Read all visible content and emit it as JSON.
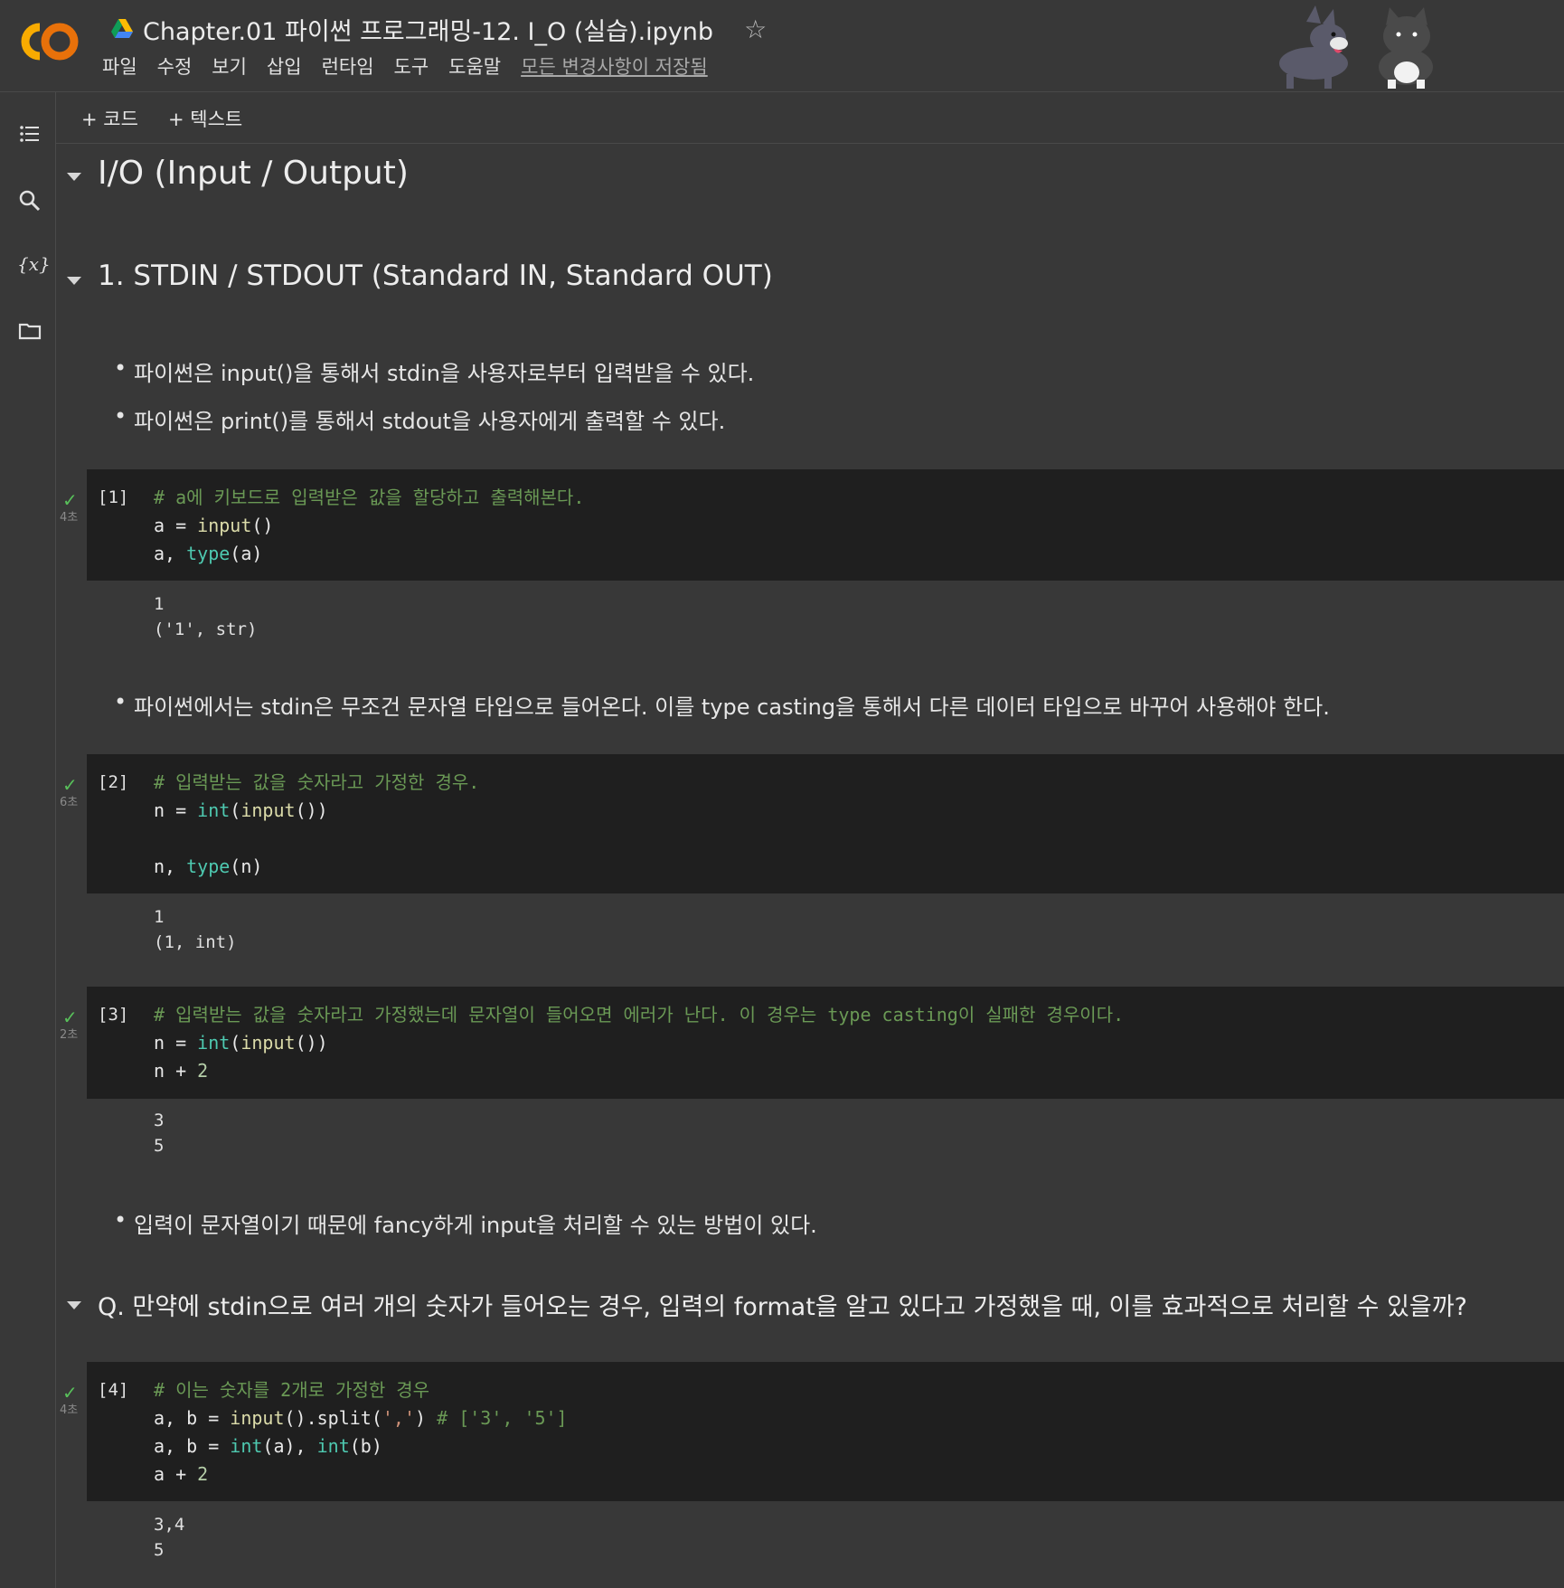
{
  "header": {
    "title": "Chapter.01 파이썬 프로그래밍-12. I_O (실습).ipynb",
    "menu": [
      "파일",
      "수정",
      "보기",
      "삽입",
      "런타임",
      "도구",
      "도움말"
    ],
    "saved_status": "모든 변경사항이 저장됨"
  },
  "toolbar": {
    "add_code": "+ 코드",
    "add_text": "+ 텍스트"
  },
  "sidebar": {
    "icons": [
      "toc-icon",
      "search-icon",
      "variables-icon",
      "folder-icon"
    ],
    "variables_label": "{x}"
  },
  "content": {
    "h1": "I/O (Input / Output)",
    "h2": "1. STDIN / STDOUT (Standard IN, Standard OUT)",
    "bullet1": "파이썬은 input()을 통해서 stdin을 사용자로부터 입력받을 수 있다.",
    "bullet2": "파이썬은 print()를 통해서 stdout을 사용자에게 출력할 수 있다.",
    "bullet3": "파이썬에서는 stdin은 무조건 문자열 타입으로 들어온다. 이를 type casting을 통해서 다른 데이터 타입으로 바꾸어 사용해야 한다.",
    "bullet4": "입력이 문자열이기 때문에 fancy하게 input을 처리할 수 있는 방법이 있다.",
    "h3": "Q. 만약에 stdin으로 여러 개의 숫자가 들어오는 경우, 입력의 format을 알고 있다고 가정했을 때, 이를 효과적으로 처리할 수 있을까?",
    "cells": [
      {
        "num": "[1]",
        "duration": "4초",
        "comment": "# a에 키보드로 입력받은 값을 할당하고 출력해본다.",
        "output": [
          "1",
          "('1', str)"
        ]
      },
      {
        "num": "[2]",
        "duration": "6초",
        "comment": "# 입력받는 값을 숫자라고 가정한 경우.",
        "output": [
          "1",
          "(1, int)"
        ]
      },
      {
        "num": "[3]",
        "duration": "2초",
        "comment": "# 입력받는 값을 숫자라고 가정했는데 문자열이 들어오면 에러가 난다. 이 경우는 type casting이 실패한 경우이다.",
        "output": [
          "3",
          "5"
        ]
      },
      {
        "num": "[4]",
        "duration": "4초",
        "comment": "# 이는 숫자를 2개로 가정한 경우",
        "inline_comment": "# ['3', '5']",
        "output": [
          "3,4",
          "5"
        ]
      }
    ]
  },
  "colors": {
    "background": "#383838",
    "cell_bg": "#1f1f1f",
    "comment": "#6a9955",
    "check": "#58c05a"
  }
}
